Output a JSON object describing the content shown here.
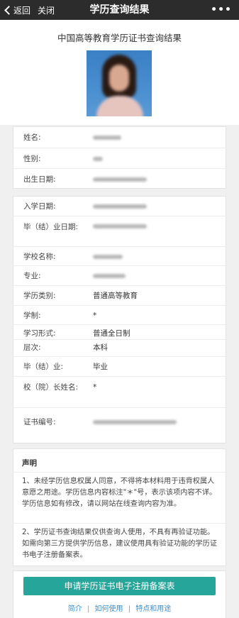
{
  "topbar": {
    "back_label": "返回",
    "close_label": "关闭",
    "title": "学历查询结果",
    "more_label": "•••"
  },
  "header": {
    "heading": "中国高等教育学历证书查询结果"
  },
  "personal": [
    {
      "label": "姓名:",
      "value": null
    },
    {
      "label": "性别:",
      "value": null
    },
    {
      "label": "出生日期:",
      "value": null
    }
  ],
  "education": [
    {
      "label": "入学日期:",
      "value": null
    },
    {
      "label": "毕（结）业日期:",
      "value": null
    },
    {
      "label": "学校名称:",
      "value": null
    },
    {
      "label": "专业:",
      "value": null
    },
    {
      "label": "学历类别:",
      "value": "普通高等教育"
    },
    {
      "label": "学制:",
      "value": "*"
    },
    {
      "label": "学习形式:",
      "value": "普通全日制"
    },
    {
      "label": "层次:",
      "value": "本科"
    },
    {
      "label": "毕（结）业:",
      "value": "毕业"
    },
    {
      "label": "校（院）长姓名:",
      "value": "*"
    },
    {
      "label": "证书编号:",
      "value": null
    }
  ],
  "notice": {
    "title": "声明",
    "paragraphs": [
      "1、未经学历信息权属人同意，不得将本材料用于违背权属人意愿之用途。学历信息内容标注\"＊\"号，表示该项内容不详。学历信息如有修改，请以网站在线查询内容为准。",
      "2、学历证书查询结果仅供查询人使用，不具有再验证功能。如需向第三方提供学历信息，建议使用具有验证功能的学历证书电子注册备案表。"
    ]
  },
  "apply": {
    "button_label": "申请学历证书电子注册备案表",
    "links": [
      "简介",
      "如何使用",
      "特点和用途"
    ],
    "separator": "|"
  },
  "colors": {
    "topbar_bg": "#2c2c2c",
    "button_bg": "#26a69a",
    "link": "#3a8fd1",
    "page_bg": "#f0f0f0"
  }
}
